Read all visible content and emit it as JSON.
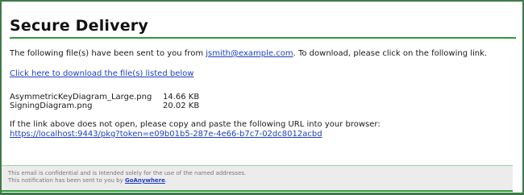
{
  "email": {
    "title": "Secure Delivery",
    "intro": {
      "before": "The following file(s) have been sent to you from ",
      "sender": "jsmith@example.com",
      "after": ". To download, please click on the following link."
    },
    "download_link": "Click here to download the file(s) listed below",
    "files": [
      {
        "name": "AsymmetricKeyDiagram_Large.png",
        "size": "14.66 KB"
      },
      {
        "name": "SigningDiagram.png",
        "size": "20.02 KB"
      }
    ],
    "fallback_text": "If the link above does not open, please copy and paste the following URL into your browser:",
    "url": "https://localhost:9443/pkg?token=e09b01b5-287e-4e66-b7c7-02dc8012acbd",
    "footer": {
      "confidential": "This email is confidential and is intended solely for the use of the named addresses.",
      "sent_by_prefix": "This notification has been sent to you by ",
      "sent_by_link": "GoAnywhere",
      "sent_by_suffix": "."
    }
  },
  "colors": {
    "border": "#3f7a4a",
    "accent_green": "#2e9a3a",
    "link": "#1f3fbf",
    "footer_bg": "#ececec"
  }
}
